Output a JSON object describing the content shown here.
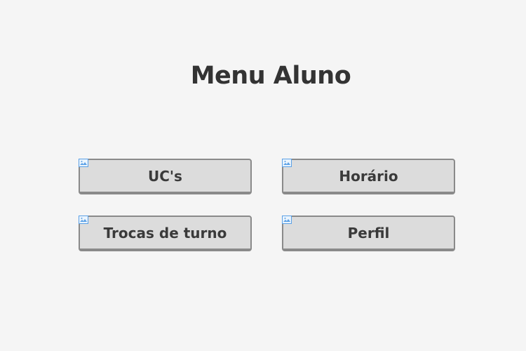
{
  "page": {
    "title": "Menu Aluno"
  },
  "menu": {
    "buttons": [
      {
        "label": "UC's",
        "icon": "broken-image-icon"
      },
      {
        "label": "Horário",
        "icon": "broken-image-icon"
      },
      {
        "label": "Trocas de turno",
        "icon": "broken-image-icon"
      },
      {
        "label": "Perfil",
        "icon": "broken-image-icon"
      }
    ]
  },
  "colors": {
    "background": "#f5f5f5",
    "button_face": "#dcdcdc",
    "button_border": "#8a8a8a",
    "text": "#333333",
    "icon_accent": "#5aa0e6"
  }
}
